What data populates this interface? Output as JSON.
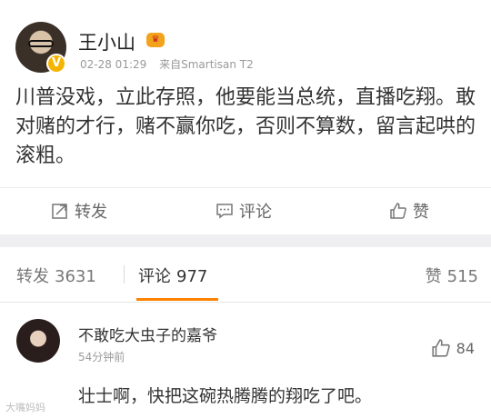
{
  "post": {
    "author": "王小山",
    "timestamp": "02-28 01:29",
    "source": "来自Smartisan T2",
    "text": "川普没戏，立此存照，他要能当总统，直播吃翔。敢对赌的才行，赌不赢你吃，否则不算数，留言起哄的滚粗。",
    "actions": {
      "forward": "转发",
      "comment": "评论",
      "like": "赞"
    }
  },
  "tabs": {
    "forward_label": "转发",
    "forward_count": "3631",
    "comments_label": "评论",
    "comments_count": "977",
    "likes_label": "赞",
    "likes_count": "515"
  },
  "comment": {
    "name": "不敢吃大虫子的嘉爷",
    "time": "54分钟前",
    "likes": "84",
    "text": "壮士啊，快把这碗热腾腾的翔吃了吧。"
  },
  "watermark": "大嘴妈妈",
  "colors": {
    "accent": "#ff8200",
    "badge": "#f5b400"
  }
}
